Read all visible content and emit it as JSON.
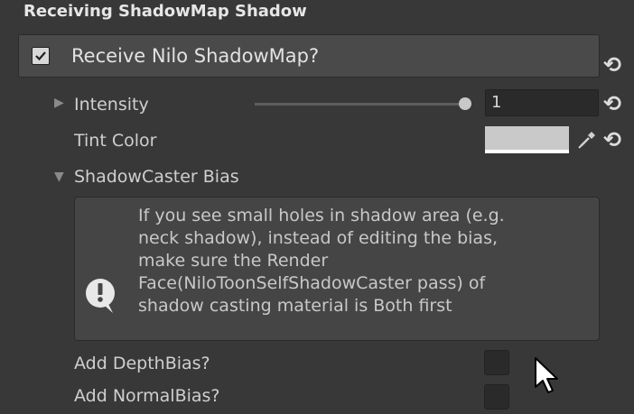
{
  "section": {
    "title": "Receiving ShadowMap Shadow"
  },
  "toggle": {
    "label": "Receive Nilo ShadowMap?",
    "checked": true
  },
  "intensity": {
    "label": "Intensity",
    "value": "1",
    "slider_fraction": 1.0
  },
  "tint": {
    "label": "Tint Color",
    "color": "#c9c9c9"
  },
  "bias": {
    "label": "ShadowCaster Bias",
    "help_lines": [
      "If you see small holes in shadow area (e.g.",
      "neck shadow), instead of editing the bias,",
      "make sure the Render",
      "Face(NiloToonSelfShadowCaster pass) of",
      "shadow casting material is Both first"
    ],
    "depth_bias_label": "Add DepthBias?",
    "normal_bias_label": "Add NormalBias?"
  },
  "icons": {
    "revert": "revert-icon",
    "picker": "eyedropper-icon",
    "help": "warning-icon",
    "cursor": "mouse-cursor-icon"
  },
  "colors": {
    "background": "#383838",
    "toggle_bg": "#4a4a4a",
    "field_bg": "#2a2a2a",
    "annotation_red": "#ff3b30"
  }
}
